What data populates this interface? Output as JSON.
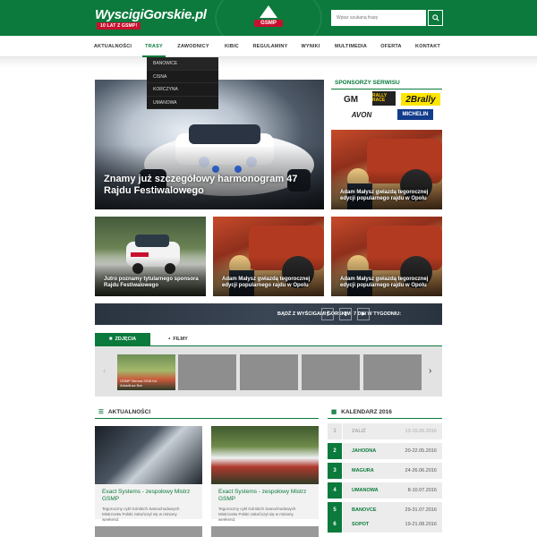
{
  "header": {
    "logo": "WyscigiGorskie.pl",
    "logo_sub": "10 LAT Z GSMP!",
    "badge": "GSMP",
    "search_placeholder": "Wpisz szukaną frazę"
  },
  "nav": {
    "items": [
      "AKTUALNOŚCI",
      "TRASY",
      "ZAWODNICY",
      "KIBIC",
      "REGULAMINY",
      "WYNIKI",
      "MULTIMEDIA",
      "OFERTA",
      "KONTAKT"
    ],
    "active": "TRASY"
  },
  "dropdown": {
    "items": [
      "BANOWICE",
      "CISNA",
      "KORCZYNA",
      "UMANOWA"
    ]
  },
  "hero": {
    "title": "Znamy już szczegółowy harmonogram 47 Rajdu Festiwalowego"
  },
  "tiles": [
    {
      "caption": "Adam Małysz gwiazdą tegorocznej edycji popularnego rajdu w Opolu"
    },
    {
      "caption": "Jutro poznamy tytularnego sponsora Rajdu Festiwalowego"
    },
    {
      "caption": "Adam Małysz gwiazdą tegorocznej edycji popularnego rajdu w Opolu"
    },
    {
      "caption": "Adam Małysz gwiazdą tegorocznej edycji popularnego rajdu w Opolu"
    }
  ],
  "sponsors": {
    "title": "SPONSORZY SERWISU",
    "logos": [
      "GM",
      "RALLY RACE",
      "2Brally",
      "AVON",
      "MICHELIN"
    ]
  },
  "social": {
    "text": "BĄDŹ Z WYŚCIGAMI GÓRSKIMI 7 DNI W TYGODNIU:",
    "facebook": "f",
    "twitter": "t",
    "youtube": "▶"
  },
  "gallery": {
    "tabs": [
      "ZDJĘCIA",
      "FILMY"
    ],
    "first_caption": "GSMP Sienna 2016 fot. Arkadiusz Bar"
  },
  "news": {
    "title": "AKTUALNOŚCI",
    "items": [
      {
        "title": "Exact Systems - zespołowy Mistrz GSMP",
        "desc": "Tegoroczny cykl Górskich Samochodowych Mistrzostw Polski zakończył się w miniony weekend."
      },
      {
        "title": "Exact Systems - zespołowy Mistrz GSMP",
        "desc": "Tegoroczny cykl Górskich Samochodowych Mistrzostw Polski zakończył się w miniony weekend."
      }
    ]
  },
  "calendar": {
    "title": "KALENDARZ 2016",
    "rows": [
      {
        "num": "1",
        "name": "ZALIŻ",
        "date": "13-15.05.2016",
        "past": true
      },
      {
        "num": "2",
        "name": "JAHODNA",
        "date": "20-22.05.2016",
        "past": false
      },
      {
        "num": "3",
        "name": "MAGURA",
        "date": "24-26.06.2016",
        "past": false
      },
      {
        "num": "4",
        "name": "UMANOWA",
        "date": "8-10.07.2016",
        "past": false
      },
      {
        "num": "5",
        "name": "BANOVCE",
        "date": "29-31.07.2016",
        "past": false
      },
      {
        "num": "6",
        "name": "SOPOT",
        "date": "19-21.08.2016",
        "past": false
      }
    ]
  }
}
